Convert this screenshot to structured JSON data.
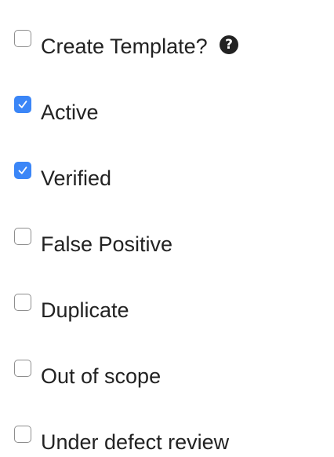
{
  "form": {
    "options": [
      {
        "label": "Create Template?",
        "checked": false,
        "help_icon": "question-circle-icon",
        "help_glyph": "?"
      },
      {
        "label": "Active",
        "checked": true
      },
      {
        "label": "Verified",
        "checked": true
      },
      {
        "label": "False Positive",
        "checked": false
      },
      {
        "label": "Duplicate",
        "checked": false
      },
      {
        "label": "Out of scope",
        "checked": false
      },
      {
        "label": "Under defect review",
        "checked": false
      }
    ],
    "colors": {
      "checked_fill": "#3b86f7",
      "unchecked_border": "#8e8e8e",
      "text": "#222222"
    }
  }
}
